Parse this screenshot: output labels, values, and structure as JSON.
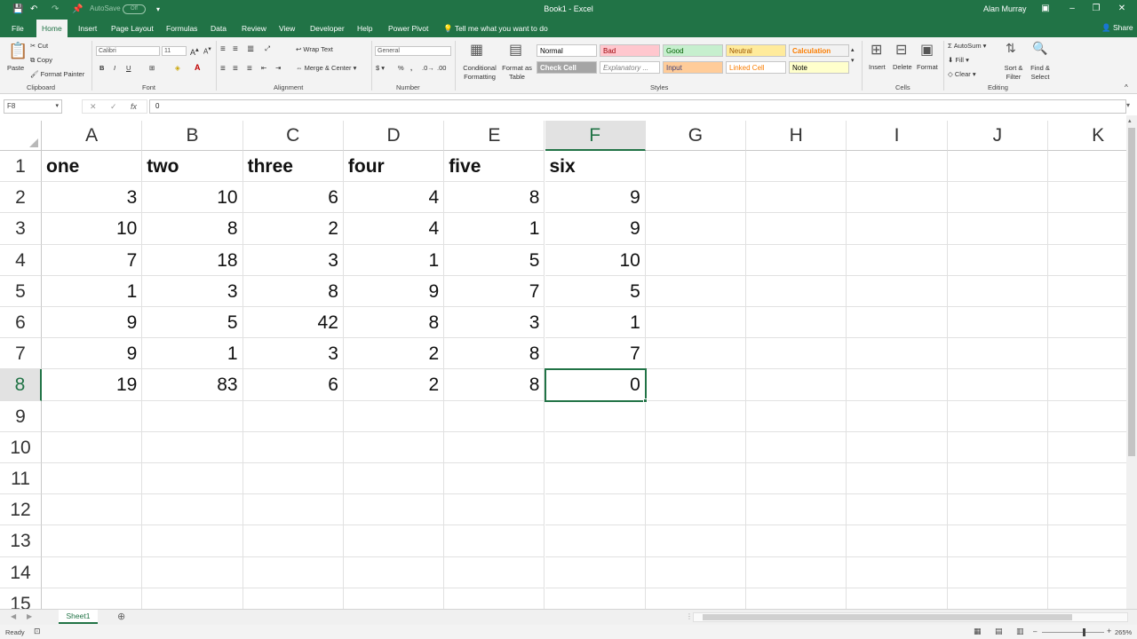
{
  "titlebar": {
    "autosave_label": "AutoSave",
    "autosave_state": "Off",
    "title": "Book1 - Excel",
    "user": "Alan Murray"
  },
  "tabs": [
    "File",
    "Home",
    "Insert",
    "Page Layout",
    "Formulas",
    "Data",
    "Review",
    "View",
    "Developer",
    "Help",
    "Power Pivot"
  ],
  "active_tab": "Home",
  "tell_me": "Tell me what you want to do",
  "share": "Share",
  "ribbon": {
    "clipboard": {
      "paste": "Paste",
      "cut": "Cut",
      "copy": "Copy",
      "format_painter": "Format Painter",
      "label": "Clipboard"
    },
    "font": {
      "name": "Calibri",
      "size": "11",
      "label": "Font"
    },
    "alignment": {
      "wrap": "Wrap Text",
      "merge": "Merge & Center",
      "label": "Alignment"
    },
    "number": {
      "format": "General",
      "label": "Number"
    },
    "styles": {
      "conditional": "Conditional Formatting",
      "format_table": "Format as Table",
      "cells": [
        {
          "name": "Normal",
          "bg": "#ffffff",
          "fg": "#000000"
        },
        {
          "name": "Bad",
          "bg": "#ffc7ce",
          "fg": "#9c0006"
        },
        {
          "name": "Good",
          "bg": "#c6efce",
          "fg": "#006100"
        },
        {
          "name": "Neutral",
          "bg": "#ffeb9c",
          "fg": "#9c5700"
        },
        {
          "name": "Calculation",
          "bg": "#f2f2f2",
          "fg": "#fa7d00"
        },
        {
          "name": "Check Cell",
          "bg": "#a5a5a5",
          "fg": "#ffffff"
        },
        {
          "name": "Explanatory ...",
          "bg": "#ffffff",
          "fg": "#7f7f7f"
        },
        {
          "name": "Input",
          "bg": "#ffcc99",
          "fg": "#3f3f76"
        },
        {
          "name": "Linked Cell",
          "bg": "#ffffff",
          "fg": "#fa7d00"
        },
        {
          "name": "Note",
          "bg": "#ffffcc",
          "fg": "#000000"
        }
      ],
      "label": "Styles"
    },
    "cells": {
      "insert": "Insert",
      "delete": "Delete",
      "format": "Format",
      "label": "Cells"
    },
    "editing": {
      "autosum": "AutoSum",
      "fill": "Fill",
      "clear": "Clear",
      "sort": "Sort & Filter",
      "find": "Find & Select",
      "label": "Editing"
    }
  },
  "formula_bar": {
    "name_box": "F8",
    "value": "0"
  },
  "columns": [
    "A",
    "B",
    "C",
    "D",
    "E",
    "F",
    "G",
    "H",
    "I",
    "J",
    "K"
  ],
  "rows": [
    "1",
    "2",
    "3",
    "4",
    "5",
    "6",
    "7",
    "8",
    "9",
    "10",
    "11",
    "12",
    "13",
    "14",
    "15"
  ],
  "headers": [
    "one",
    "two",
    "three",
    "four",
    "five",
    "six"
  ],
  "data": [
    [
      3,
      10,
      6,
      4,
      8,
      9
    ],
    [
      10,
      8,
      2,
      4,
      1,
      9
    ],
    [
      7,
      18,
      3,
      1,
      5,
      10
    ],
    [
      1,
      3,
      8,
      9,
      7,
      5
    ],
    [
      9,
      5,
      42,
      8,
      3,
      1
    ],
    [
      9,
      1,
      3,
      2,
      8,
      7
    ],
    [
      19,
      83,
      6,
      2,
      8,
      0
    ]
  ],
  "selected": {
    "column": "F",
    "row": "8"
  },
  "sheet_tab": "Sheet1",
  "status": {
    "ready": "Ready",
    "zoom": "265%"
  }
}
